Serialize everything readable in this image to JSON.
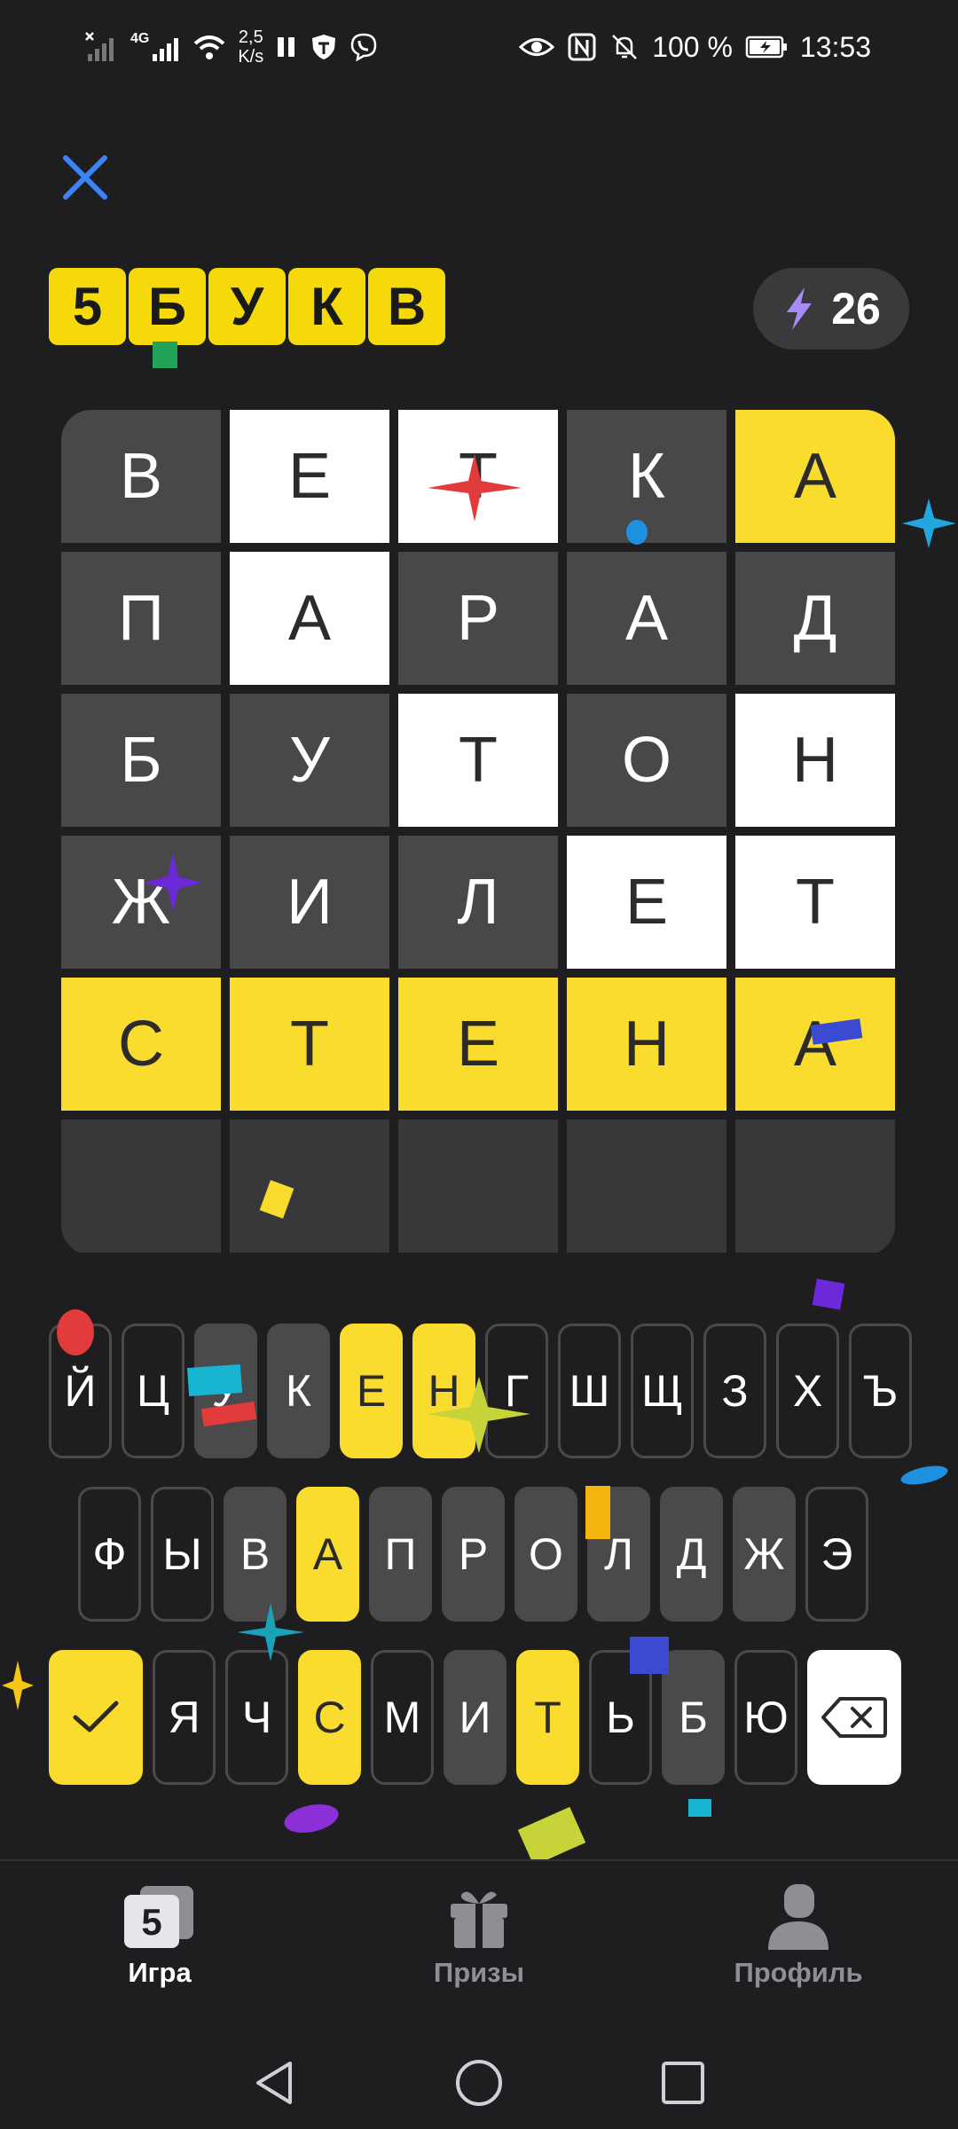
{
  "status_bar": {
    "network": "4G",
    "speed_value": "2,5",
    "speed_unit": "K/s",
    "battery": "100 %",
    "time": "13:53"
  },
  "header": {
    "logo_letters": [
      "5",
      "Б",
      "У",
      "К",
      "В"
    ],
    "energy_count": "26"
  },
  "board": {
    "rows": [
      [
        {
          "letter": "В",
          "state": "absent"
        },
        {
          "letter": "Е",
          "state": "present"
        },
        {
          "letter": "Т",
          "state": "present"
        },
        {
          "letter": "К",
          "state": "absent"
        },
        {
          "letter": "А",
          "state": "correct"
        }
      ],
      [
        {
          "letter": "П",
          "state": "absent"
        },
        {
          "letter": "А",
          "state": "present"
        },
        {
          "letter": "Р",
          "state": "absent"
        },
        {
          "letter": "А",
          "state": "absent"
        },
        {
          "letter": "Д",
          "state": "absent"
        }
      ],
      [
        {
          "letter": "Б",
          "state": "absent"
        },
        {
          "letter": "У",
          "state": "absent"
        },
        {
          "letter": "Т",
          "state": "present"
        },
        {
          "letter": "О",
          "state": "absent"
        },
        {
          "letter": "Н",
          "state": "present"
        }
      ],
      [
        {
          "letter": "Ж",
          "state": "absent"
        },
        {
          "letter": "И",
          "state": "absent"
        },
        {
          "letter": "Л",
          "state": "absent"
        },
        {
          "letter": "Е",
          "state": "present"
        },
        {
          "letter": "Т",
          "state": "present"
        }
      ],
      [
        {
          "letter": "С",
          "state": "correct"
        },
        {
          "letter": "Т",
          "state": "correct"
        },
        {
          "letter": "Е",
          "state": "correct"
        },
        {
          "letter": "Н",
          "state": "correct"
        },
        {
          "letter": "А",
          "state": "correct"
        }
      ],
      [
        {
          "letter": "",
          "state": "empty"
        },
        {
          "letter": "",
          "state": "empty"
        },
        {
          "letter": "",
          "state": "empty"
        },
        {
          "letter": "",
          "state": "empty"
        },
        {
          "letter": "",
          "state": "empty"
        }
      ]
    ]
  },
  "keyboard": {
    "row1": [
      {
        "key": "Й",
        "state": "unused"
      },
      {
        "key": "Ц",
        "state": "unused"
      },
      {
        "key": "У",
        "state": "absent"
      },
      {
        "key": "К",
        "state": "absent"
      },
      {
        "key": "Е",
        "state": "present"
      },
      {
        "key": "Н",
        "state": "present"
      },
      {
        "key": "Г",
        "state": "unused"
      },
      {
        "key": "Ш",
        "state": "unused"
      },
      {
        "key": "Щ",
        "state": "unused"
      },
      {
        "key": "З",
        "state": "unused"
      },
      {
        "key": "Х",
        "state": "unused"
      },
      {
        "key": "Ъ",
        "state": "unused"
      }
    ],
    "row2": [
      {
        "key": "Ф",
        "state": "unused"
      },
      {
        "key": "Ы",
        "state": "unused"
      },
      {
        "key": "В",
        "state": "absent"
      },
      {
        "key": "А",
        "state": "present"
      },
      {
        "key": "П",
        "state": "absent"
      },
      {
        "key": "Р",
        "state": "absent"
      },
      {
        "key": "О",
        "state": "absent"
      },
      {
        "key": "Л",
        "state": "absent"
      },
      {
        "key": "Д",
        "state": "absent"
      },
      {
        "key": "Ж",
        "state": "absent"
      },
      {
        "key": "Э",
        "state": "unused"
      }
    ],
    "row3": [
      {
        "key": "Я",
        "state": "unused"
      },
      {
        "key": "Ч",
        "state": "unused"
      },
      {
        "key": "С",
        "state": "present"
      },
      {
        "key": "М",
        "state": "unused"
      },
      {
        "key": "И",
        "state": "absent"
      },
      {
        "key": "Т",
        "state": "present"
      },
      {
        "key": "Ь",
        "state": "unused"
      },
      {
        "key": "Б",
        "state": "absent"
      },
      {
        "key": "Ю",
        "state": "unused"
      }
    ]
  },
  "bottom_nav": {
    "items": [
      {
        "label": "Игра",
        "icon": "game-logo-icon",
        "active": true
      },
      {
        "label": "Призы",
        "icon": "gift-icon",
        "active": false
      },
      {
        "label": "Профиль",
        "icon": "profile-icon",
        "active": false
      }
    ],
    "game_icon_glyph": "5"
  },
  "colors": {
    "background": "#1e1e20",
    "correct": "#f9dc2d",
    "present": "#ffffff",
    "absent": "#48484a",
    "accent_close": "#3b82f6",
    "energy_bolt": "#a78bfa"
  }
}
